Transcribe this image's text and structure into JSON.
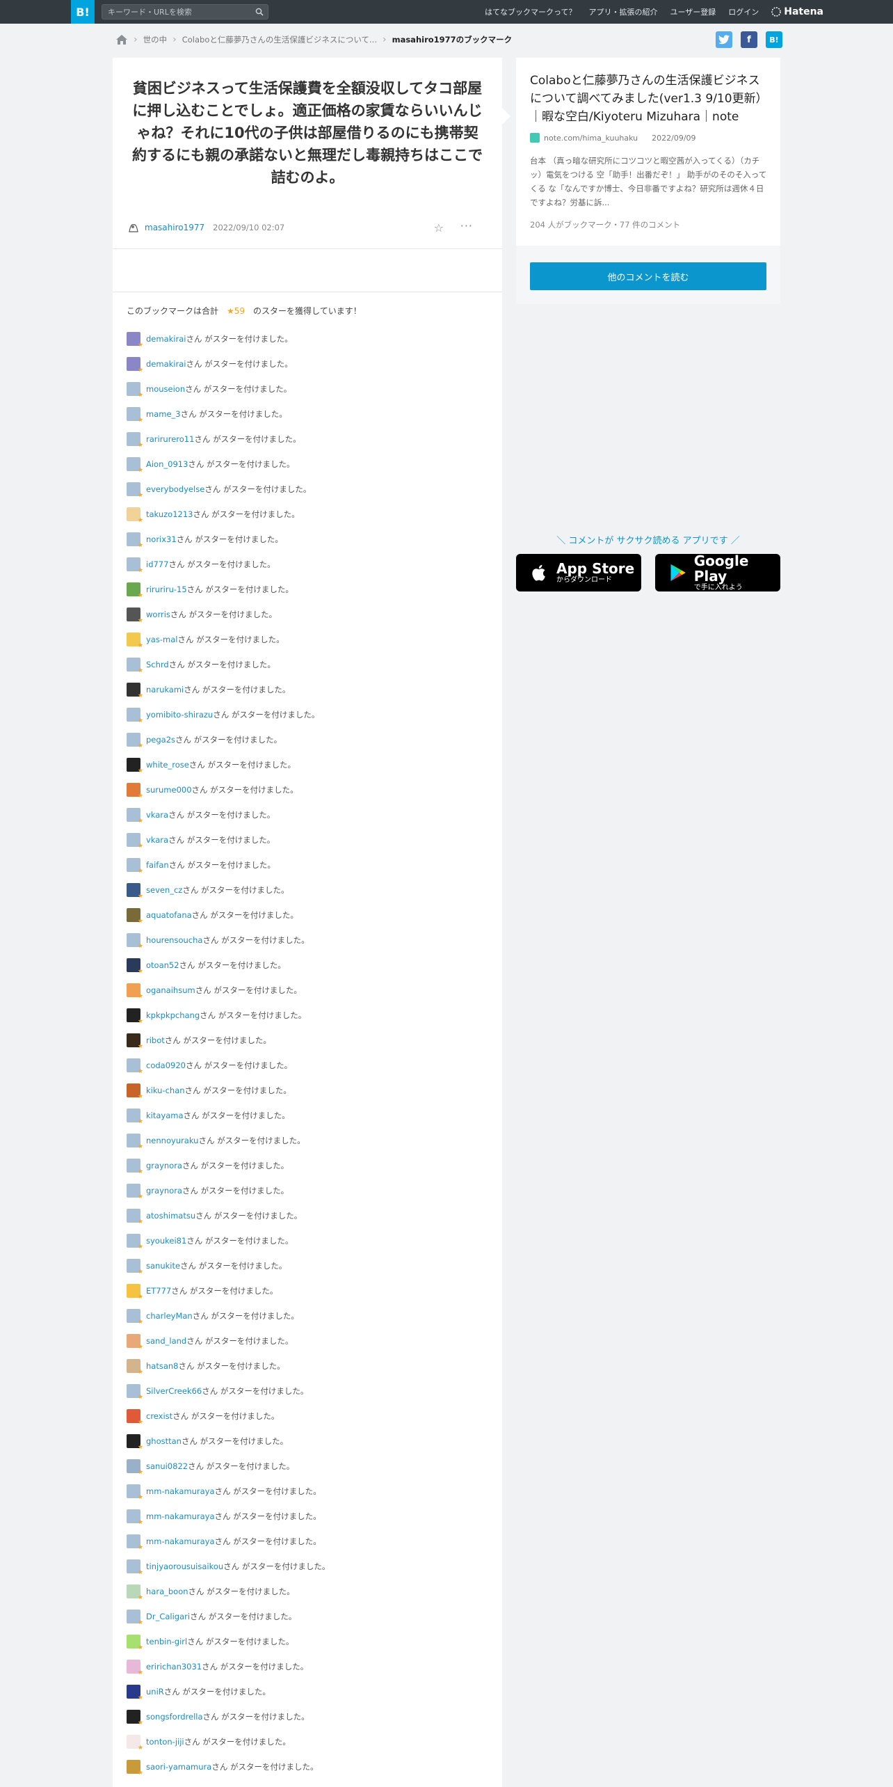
{
  "header": {
    "logo": "B!",
    "search_placeholder": "キーワード・URLを検索",
    "nav": [
      "はてなブックマークって？",
      "アプリ・拡張の紹介",
      "ユーザー登録",
      "ログイン"
    ],
    "brand": "Hatena"
  },
  "breadcrumb": {
    "items": [
      "世の中",
      "Colaboと仁藤夢乃さんの生活保護ビジネスについて...",
      "masahiro1977のブックマーク"
    ]
  },
  "share": {
    "twitter": "t",
    "facebook": "f",
    "hatebu": "B!"
  },
  "bookmark": {
    "comment": "貧困ビジネスって生活保護費を全額没収してタコ部屋に押し込むことでしょ。適正価格の家賃ならいいんじゃね？それに10代の子供は部屋借りるのにも携帯契約するにも親の承諾ないと無理だし毒親持ちはここで詰むのよ。",
    "user": "masahiro1977",
    "date": "2022/09/10 02:07",
    "star_add_icon": "☆",
    "more_icon": "···"
  },
  "stars": {
    "summary_prefix": "このブックマークは合計",
    "total": "★59",
    "summary_suffix": "のスターを獲得しています！",
    "suffix": "さん がスターを付けました。",
    "users": [
      {
        "name": "demakirai",
        "color": "#8a86c8"
      },
      {
        "name": "demakirai",
        "color": "#8a86c8"
      },
      {
        "name": "mouseion",
        "color": "#a9bfd6"
      },
      {
        "name": "mame_3",
        "color": "#a9bfd6"
      },
      {
        "name": "rarirurero11",
        "color": "#a9bfd6"
      },
      {
        "name": "Aion_0913",
        "color": "#a9bfd6"
      },
      {
        "name": "everybodyelse",
        "color": "#a9bfd6"
      },
      {
        "name": "takuzo1213",
        "color": "#f1d39a"
      },
      {
        "name": "norix31",
        "color": "#a9bfd6"
      },
      {
        "name": "id777",
        "color": "#a9bfd6"
      },
      {
        "name": "riruriru-15",
        "color": "#6aa84f"
      },
      {
        "name": "worris",
        "color": "#555555"
      },
      {
        "name": "yas-mal",
        "color": "#f2c94c"
      },
      {
        "name": "Schrd",
        "color": "#a9bfd6"
      },
      {
        "name": "narukami",
        "color": "#333333"
      },
      {
        "name": "yomibito-shirazu",
        "color": "#a9bfd6"
      },
      {
        "name": "pega2s",
        "color": "#a9bfd6"
      },
      {
        "name": "white_rose",
        "color": "#222222"
      },
      {
        "name": "surume000",
        "color": "#e07b39"
      },
      {
        "name": "vkara",
        "color": "#a9bfd6"
      },
      {
        "name": "vkara",
        "color": "#a9bfd6"
      },
      {
        "name": "faifan",
        "color": "#a9bfd6"
      },
      {
        "name": "seven_cz",
        "color": "#3a5a8a"
      },
      {
        "name": "aquatofana",
        "color": "#7a6a3a"
      },
      {
        "name": "hourensoucha",
        "color": "#a9bfd6"
      },
      {
        "name": "otoan52",
        "color": "#2a3a5a"
      },
      {
        "name": "oganaihsum",
        "color": "#f0a050"
      },
      {
        "name": "kpkpkpchang",
        "color": "#222222"
      },
      {
        "name": "ribot",
        "color": "#3a2a1a"
      },
      {
        "name": "coda0920",
        "color": "#a9bfd6"
      },
      {
        "name": "kiku-chan",
        "color": "#c8642a"
      },
      {
        "name": "kitayama",
        "color": "#a9bfd6"
      },
      {
        "name": "nennoyuraku",
        "color": "#a9bfd6"
      },
      {
        "name": "graynora",
        "color": "#a9bfd6"
      },
      {
        "name": "graynora",
        "color": "#a9bfd6"
      },
      {
        "name": "atoshimatsu",
        "color": "#a9bfd6"
      },
      {
        "name": "syoukei81",
        "color": "#a9bfd6"
      },
      {
        "name": "sanukite",
        "color": "#a9bfd6"
      },
      {
        "name": "ET777",
        "color": "#f5c242"
      },
      {
        "name": "charleyMan",
        "color": "#a9bfd6"
      },
      {
        "name": "sand_land",
        "color": "#e8a878"
      },
      {
        "name": "hatsan8",
        "color": "#d4b48c"
      },
      {
        "name": "SilverCreek66",
        "color": "#a9bfd6"
      },
      {
        "name": "crexist",
        "color": "#e05a3a"
      },
      {
        "name": "ghosttan",
        "color": "#222222"
      },
      {
        "name": "sanui0822",
        "color": "#9ab0c8"
      },
      {
        "name": "mm-nakamuraya",
        "color": "#a9bfd6"
      },
      {
        "name": "mm-nakamuraya",
        "color": "#a9bfd6"
      },
      {
        "name": "mm-nakamuraya",
        "color": "#a9bfd6"
      },
      {
        "name": "tinjyaorousuisaikou",
        "color": "#a9bfd6"
      },
      {
        "name": "hara_boon",
        "color": "#b8d8b8"
      },
      {
        "name": "Dr_Caligari",
        "color": "#a9bfd6"
      },
      {
        "name": "tenbin-girl",
        "color": "#a8e070"
      },
      {
        "name": "eririchan3031",
        "color": "#e8b8d8"
      },
      {
        "name": "uniR",
        "color": "#2a3a8a"
      },
      {
        "name": "songsfordrella",
        "color": "#222222"
      },
      {
        "name": "tonton-jiji",
        "color": "#f5e8e8"
      },
      {
        "name": "saori-yamamura",
        "color": "#c89a3a"
      }
    ]
  },
  "entry": {
    "title": "Colaboと仁藤夢乃さんの生活保護ビジネスについて調べてみました(ver1.3 9/10更新）｜暇な空白/Kiyoteru Mizuhara｜note",
    "source": "note.com/hima_kuuhaku",
    "date": "2022/09/09",
    "summary": "台本 （真っ暗な研究所にコツコツと暇空茜が入ってくる）（カチッ）電気をつける 空「助手！出番だぞ！」 助手がのそのそ入ってくる な「なんですか博士、今日非番ですよね？研究所は週休４日ですよね？労基に訴...",
    "count": "204 人がブックマーク・77 件のコメント",
    "read_more": "他のコメントを読む"
  },
  "app": {
    "promo": "＼ コメントが サクサク読める アプリです ／",
    "appstore_big": "App Store",
    "appstore_small": "からダウンロード",
    "googleplay_big": "Google Play",
    "googleplay_small": "で手に入れよう"
  }
}
